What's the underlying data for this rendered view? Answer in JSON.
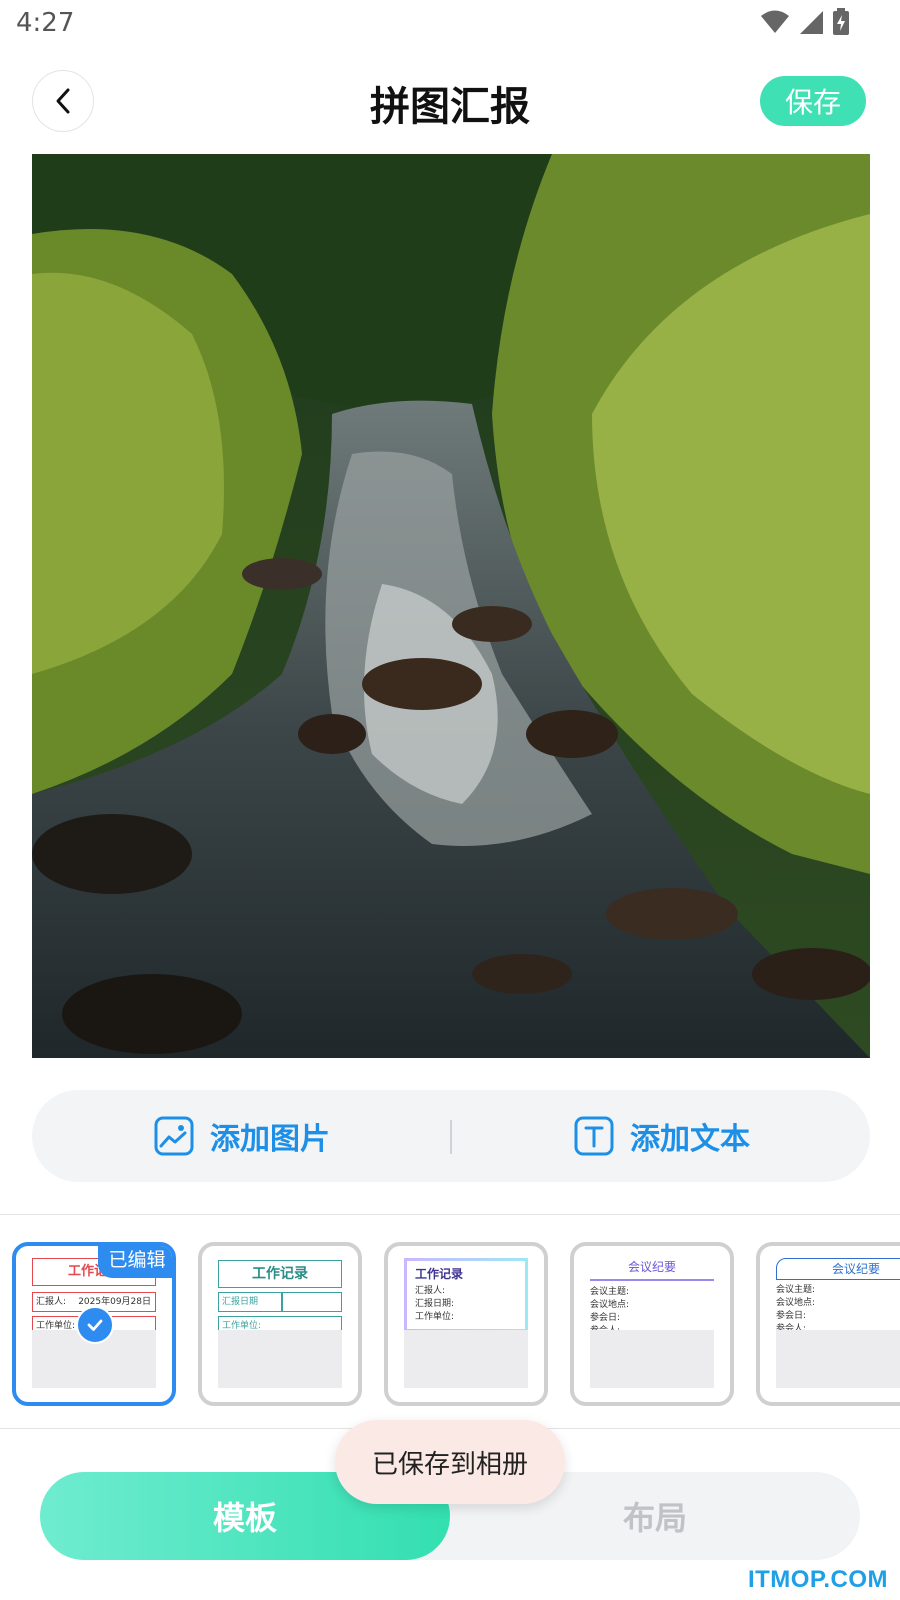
{
  "status": {
    "time": "4:27"
  },
  "header": {
    "title": "拼图汇报",
    "save_label": "保存"
  },
  "actions": {
    "add_image_label": "添加图片",
    "add_text_label": "添加文本"
  },
  "templates": {
    "edited_badge": "已编辑",
    "items": [
      {
        "title": "工作记录",
        "rows": [
          "汇报人:",
          "2025年09月28日",
          "工作单位:"
        ]
      },
      {
        "title": "工作记录",
        "rows": [
          "汇报日期",
          "工作单位:"
        ]
      },
      {
        "title": "工作记录",
        "rows": [
          "汇报人:",
          "汇报日期:",
          "工作单位:"
        ]
      },
      {
        "title": "会议纪要",
        "rows": [
          "会议主题:",
          "会议地点:",
          "参会日:",
          "参会人:"
        ]
      },
      {
        "title": "会议纪要",
        "rows": [
          "会议主题:",
          "会议地点:",
          "参会日:",
          "参会人:"
        ]
      }
    ]
  },
  "toast": "已保存到相册",
  "tabs": {
    "template_label": "模板",
    "layout_label": "布局"
  },
  "watermark": "ITMOP.COM",
  "colors": {
    "accent": "#3fe0b3",
    "blue": "#2e8bf0",
    "link": "#1e8fe6"
  }
}
